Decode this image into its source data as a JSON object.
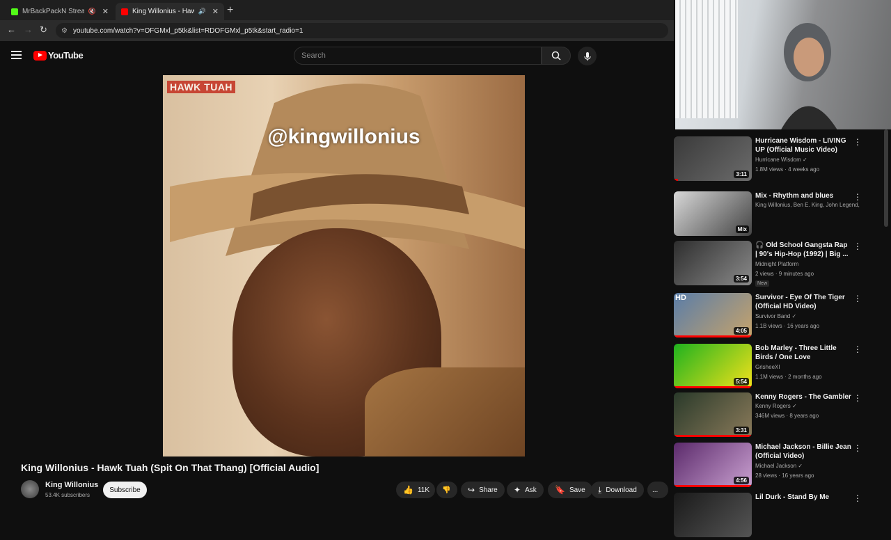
{
  "browser": {
    "tabs": [
      {
        "label": "MrBackPackN Stream - Wa",
        "favicon_color": "#53fc18",
        "active": false
      },
      {
        "label": "King Willonius - Hawk Tuah",
        "favicon_color": "#ff0000",
        "active": true
      }
    ],
    "new_tab": "+",
    "url": "youtube.com/watch?v=OFGMxl_p5tk&list=RDOFGMxl_p5tk&start_radio=1"
  },
  "youtube": {
    "logo": "YouTube",
    "search_placeholder": "Search"
  },
  "video": {
    "badge": "HAWK TUAH",
    "overlay_text": "@kingwillonius",
    "title": "King Willonius - Hawk Tuah (Spit On That Thang) [Official Audio]",
    "channel": "King Willonius",
    "subscribers": "53.4K subscribers",
    "subscribe": "Subscribe",
    "likes": "11K",
    "actions": {
      "share": "Share",
      "ask": "Ask",
      "save": "Save",
      "download": "Download",
      "more": "..."
    }
  },
  "sidebar": [
    {
      "title": "Hurricane Wisdom - LIVING UP (Official Music Video)",
      "channel": "Hurricane Wisdom",
      "verified": true,
      "meta": "1.8M views · 4 weeks ago",
      "duration": "3:11",
      "thumb": [
        "#3a3a3a",
        "#6b6b6b"
      ],
      "progress": 0.05
    },
    {
      "title": "Mix - Rhythm and blues",
      "channel": "King Willonius, Ben E. King, John Legend,...",
      "meta": "",
      "duration": "Mix",
      "thumb": [
        "#d8d8d8",
        "#444"
      ],
      "progress": 0
    },
    {
      "title": "🎧 Old School Gangsta Rap | 90's Hip-Hop (1992) | Big ...",
      "channel": "Midnight Platform",
      "meta": "2 views · 9 minutes ago",
      "badge": "New",
      "duration": "3:54",
      "thumb": [
        "#2e2e2e",
        "#8a8a8a"
      ],
      "progress": 0
    },
    {
      "title": "Survivor - Eye Of The Tiger (Official HD Video)",
      "channel": "Survivor Band",
      "verified": true,
      "meta": "1.1B views · 16 years ago",
      "duration": "4:05",
      "hd": "HD",
      "thumb": [
        "#5a7da8",
        "#c6a36b"
      ],
      "progress": 1
    },
    {
      "title": "Bob Marley - Three Little Birds / One Love",
      "channel": "GrisheeXI",
      "meta": "1.1M views · 2 months ago",
      "duration": "5:54",
      "thumb": [
        "#1fb21f",
        "#f2e11b"
      ],
      "progress": 1
    },
    {
      "title": "Kenny Rogers - The Gambler",
      "channel": "Kenny Rogers",
      "verified": true,
      "meta": "346M views · 8 years ago",
      "duration": "3:31",
      "thumb": [
        "#2a3a2a",
        "#8a7a5a"
      ],
      "progress": 1
    },
    {
      "title": "Michael Jackson - Billie Jean (Official Video)",
      "channel": "Michael Jackson",
      "verified": true,
      "meta": "28 views · 16 years ago",
      "duration": "4:56",
      "thumb": [
        "#5b2a6b",
        "#c9a0d0"
      ],
      "progress": 1
    },
    {
      "title": "Lil Durk - Stand By Me",
      "channel": "",
      "meta": "",
      "duration": "",
      "thumb": [
        "#1a1a1a",
        "#555"
      ],
      "progress": 0
    }
  ]
}
